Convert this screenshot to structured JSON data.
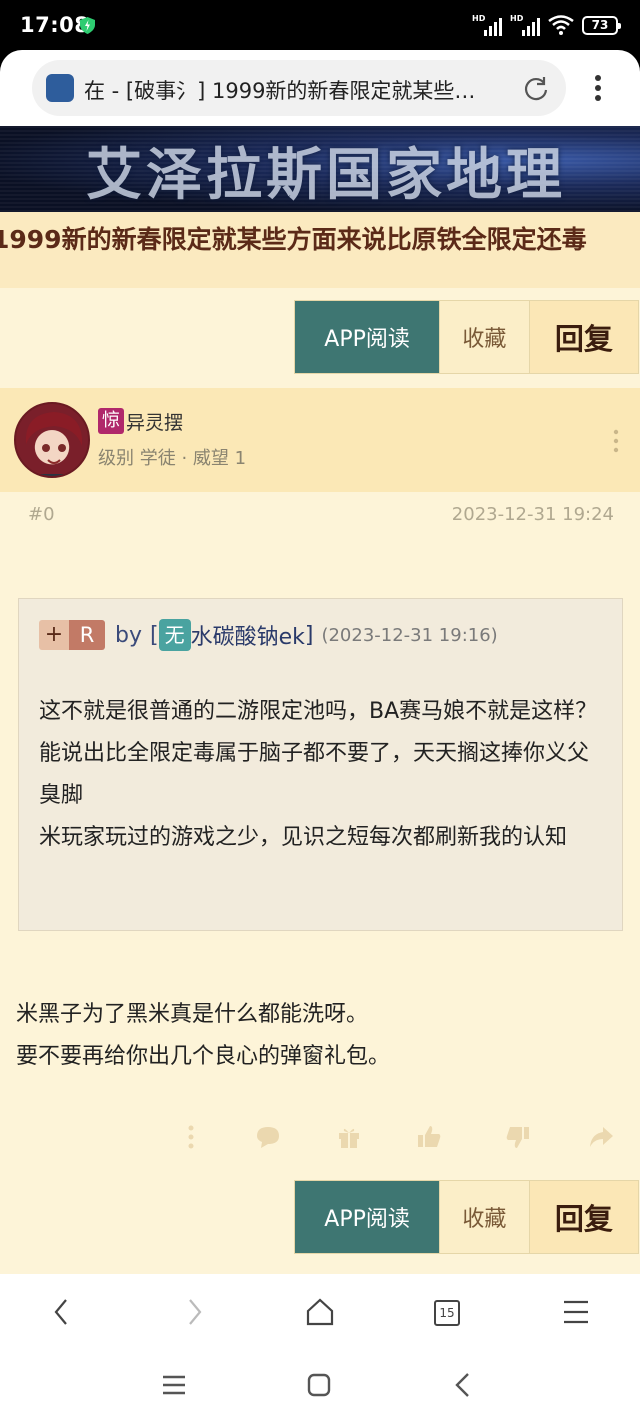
{
  "status_bar": {
    "time": "17:08",
    "battery": "73",
    "network_label": "HD"
  },
  "browser": {
    "url_text": "在 - [破事氵] 1999新的新春限定就某些…"
  },
  "site": {
    "banner_text": "艾泽拉斯国家地理"
  },
  "thread": {
    "title": "1999新的新春限定就某些方面来说比原铁全限定还毒"
  },
  "actions_bar": {
    "app_read": "APP阅读",
    "favorite": "收藏",
    "reply": "回复"
  },
  "post": {
    "badge": "惊",
    "username": "异灵摆",
    "meta": "级别 学徒 · 威望 1",
    "floor": "#0",
    "timestamp": "2023-12-31 19:24",
    "quote": {
      "plus": "+",
      "r": "R",
      "by": "by",
      "bracket_open": "[",
      "badge": "无",
      "author": "水碳酸钠ek",
      "bracket_close": "]",
      "time": "(2023-12-31 19:16)",
      "lines": [
        "这不就是很普通的二游限定池吗，BA赛马娘不就是这样？能说出比全限定毒属于脑子都不要了，天天搁这捧你义父臭脚",
        "米玩家玩过的游戏之少，见识之短每次都刷新我的认知"
      ]
    },
    "body_lines": [
      "米黑子为了黑米真是什么都能洗呀。",
      "要不要再给你出几个良心的弹窗礼包。"
    ]
  },
  "bottom_nav": {
    "tab_count": "15"
  },
  "colors": {
    "accent": "#3e7672",
    "page_bg": "#fdf4d8",
    "title_color": "#5b2a18"
  }
}
